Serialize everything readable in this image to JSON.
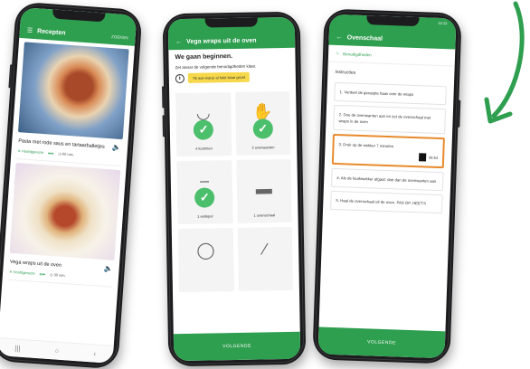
{
  "phone1": {
    "status": "ZOEKEN",
    "title": "Recepten",
    "recipes": [
      {
        "title": "Pasta met rode saus en tartaarballetjes",
        "category": "Hoofdgerecht",
        "time": "60 min."
      },
      {
        "title": "Vega wraps uit de oven",
        "category": "Hoofdgerecht",
        "time": "30 min."
      }
    ]
  },
  "phone2": {
    "title": "Vega wraps uit de oven",
    "heading": "We gaan beginnen.",
    "intro": "Zet alvast de volgende benodigdheden klaar.",
    "hint": "Tik aan wat je al hebt klaar gezet",
    "tools": [
      {
        "label": "4 kommen",
        "checked": true,
        "icon": "bowl-icon"
      },
      {
        "label": "2 ovenwanten",
        "checked": true,
        "icon": "oven-mitt-icon"
      },
      {
        "label": "1 eetlepel",
        "checked": true,
        "icon": "spoon-icon"
      },
      {
        "label": "1 ovenschaal",
        "checked": false,
        "icon": "oven-dish-icon"
      },
      {
        "label": "",
        "checked": false,
        "icon": "frying-pan-icon"
      },
      {
        "label": "",
        "checked": false,
        "icon": "ladle-icon"
      }
    ],
    "button": "VOLGENDE"
  },
  "phone3": {
    "title": "Ovenschaal",
    "status": "12:13",
    "tools_link": "Benodigdheden",
    "section": "Instructies",
    "steps": [
      "1. Verdeel de geraspte kaas over de wraps",
      "2. Doe de ovenwanten aan en zet de ovenschaal met wraps in de oven",
      "3. Druk op de wekker 7 minuten",
      "4. Als de kookwekker afgaat: doe dan de ovenwanten aan",
      "5. Haal de ovenschaal uit de oven. PAS OP, HEET!!!"
    ],
    "timer": "06:54",
    "button": "VOLGENDE"
  },
  "colors": {
    "brand_green": "#2e9e4f",
    "check_green": "#4bbf6b",
    "highlight_orange": "#e88a2c",
    "hint_yellow": "#f6d84a"
  }
}
